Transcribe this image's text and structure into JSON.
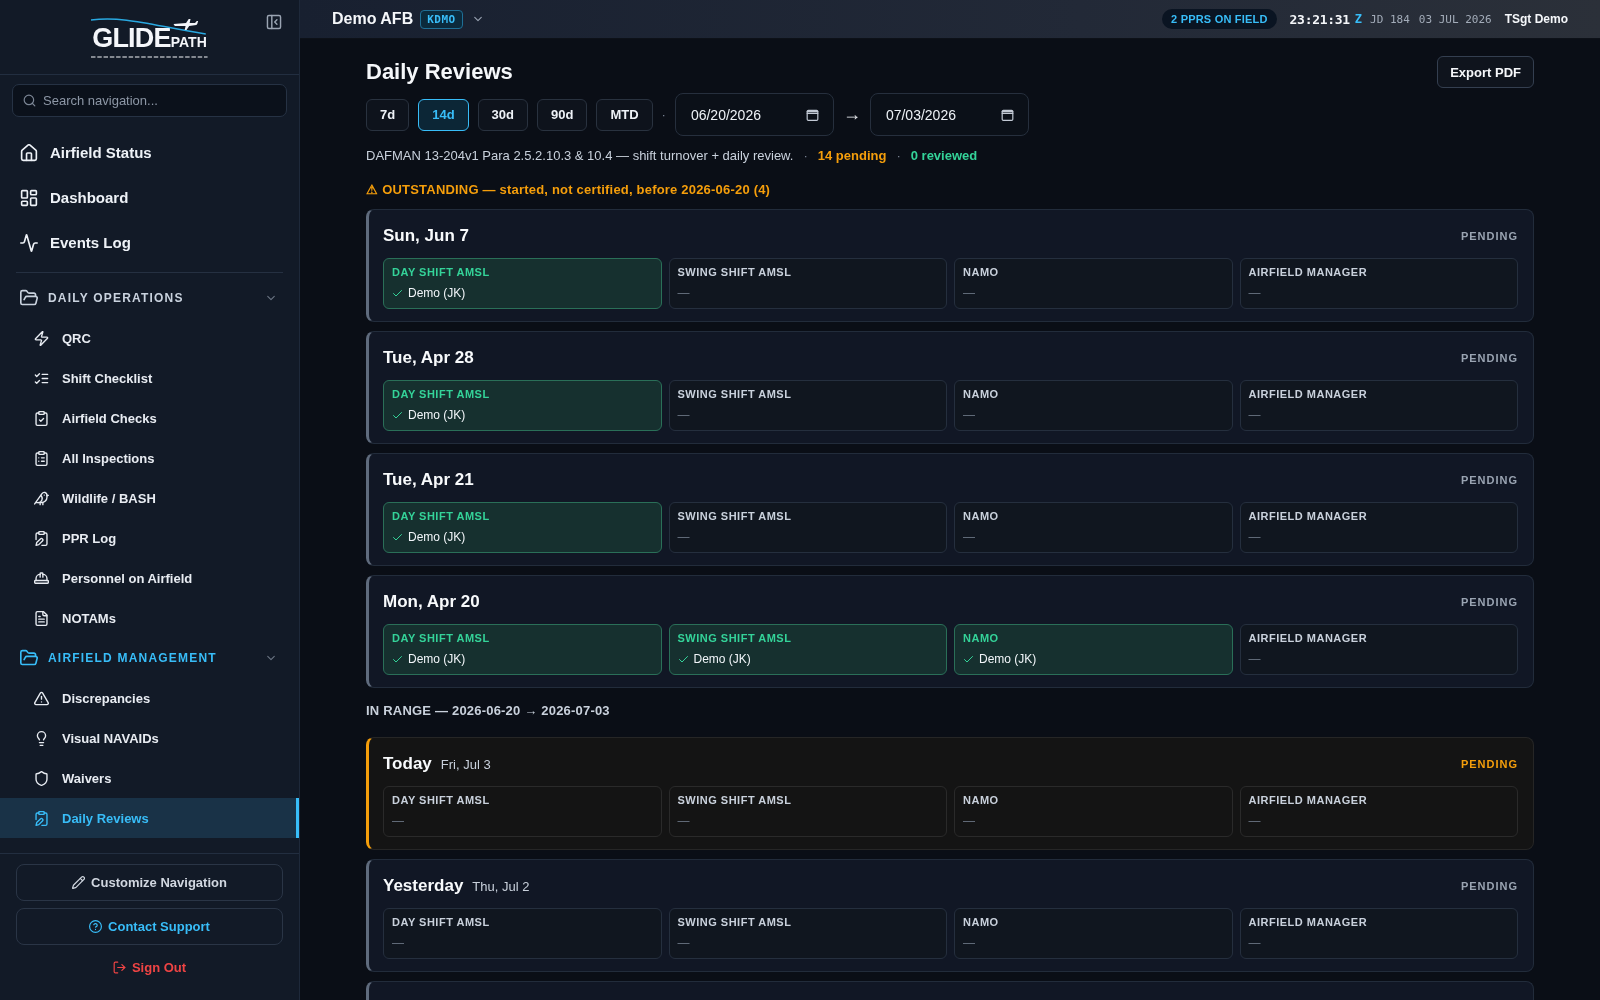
{
  "sidebar": {
    "logo": {
      "lead": "GLIDE",
      "tail": "PATH"
    },
    "search": {
      "placeholder": "Search navigation..."
    },
    "primary_items": [
      {
        "label": "Airfield Status",
        "selected": false
      },
      {
        "label": "Dashboard",
        "selected": false
      },
      {
        "label": "Events Log",
        "selected": false
      }
    ],
    "sections": [
      {
        "label": "DAILY OPERATIONS",
        "active": false,
        "expanded": true,
        "items": [
          {
            "label": "QRC",
            "selected": false
          },
          {
            "label": "Shift Checklist",
            "selected": false
          },
          {
            "label": "Airfield Checks",
            "selected": false
          },
          {
            "label": "All Inspections",
            "selected": false
          },
          {
            "label": "Wildlife / BASH",
            "selected": false
          },
          {
            "label": "PPR Log",
            "selected": false
          },
          {
            "label": "Personnel on Airfield",
            "selected": false
          },
          {
            "label": "NOTAMs",
            "selected": false
          }
        ]
      },
      {
        "label": "AIRFIELD MANAGEMENT",
        "active": true,
        "expanded": true,
        "items": [
          {
            "label": "Discrepancies",
            "selected": false
          },
          {
            "label": "Visual NAVAIDs",
            "selected": false
          },
          {
            "label": "Waivers",
            "selected": false
          },
          {
            "label": "Daily Reviews",
            "selected": true
          }
        ]
      }
    ],
    "footer_buttons": [
      {
        "kind": "customize",
        "label": "Customize Navigation"
      },
      {
        "kind": "support",
        "label": "Contact Support"
      },
      {
        "kind": "sign_out",
        "label": "Sign Out"
      }
    ]
  },
  "top_bar": {
    "base": "Demo AFB",
    "icao": "KDMO",
    "ppr_badge": "2 PPRS ON FIELD",
    "time": "23:21:31",
    "zone": "Z",
    "julian_day": "JD 184",
    "date": "03 JUL 2026",
    "user": "TSgt Demo"
  },
  "page": {
    "title": "Daily Reviews",
    "export_label": "Export PDF",
    "ranges": [
      {
        "label": "7d",
        "selected": false
      },
      {
        "label": "14d",
        "selected": true
      },
      {
        "label": "30d",
        "selected": false
      },
      {
        "label": "90d",
        "selected": false
      },
      {
        "label": "MTD",
        "selected": false
      }
    ],
    "range_separator": "·",
    "date_from": "06/20/2026",
    "date_arrow": "→",
    "date_to": "07/03/2026",
    "summary": [
      {
        "kind": "note",
        "text": "DAFMAN 13-204v1 Para 2.5.2.10.3 & 10.4 — shift turnover + daily review."
      },
      {
        "kind": "sep",
        "text": "·"
      },
      {
        "kind": "pending",
        "text": "14 pending"
      },
      {
        "kind": "sep",
        "text": "·"
      },
      {
        "kind": "reviewed",
        "text": "0 reviewed"
      }
    ]
  },
  "review_groups": [
    {
      "kind": "outstanding",
      "warning": "⚠",
      "heading": "OUTSTANDING — started, not certified, before 2026-06-20 (4)",
      "cards": [
        {
          "title": "Sun, Jun 7",
          "status": "PENDING",
          "today": false,
          "slots": [
            {
              "role": "DAY SHIFT AMSL",
              "done": true,
              "value": "Demo (JK)"
            },
            {
              "role": "SWING SHIFT AMSL",
              "done": false,
              "value": "—"
            },
            {
              "role": "NAMO",
              "done": false,
              "value": "—"
            },
            {
              "role": "AIRFIELD MANAGER",
              "done": false,
              "value": "—"
            }
          ]
        },
        {
          "title": "Tue, Apr 28",
          "status": "PENDING",
          "today": false,
          "slots": [
            {
              "role": "DAY SHIFT AMSL",
              "done": true,
              "value": "Demo (JK)"
            },
            {
              "role": "SWING SHIFT AMSL",
              "done": false,
              "value": "—"
            },
            {
              "role": "NAMO",
              "done": false,
              "value": "—"
            },
            {
              "role": "AIRFIELD MANAGER",
              "done": false,
              "value": "—"
            }
          ]
        },
        {
          "title": "Tue, Apr 21",
          "status": "PENDING",
          "today": false,
          "slots": [
            {
              "role": "DAY SHIFT AMSL",
              "done": true,
              "value": "Demo (JK)"
            },
            {
              "role": "SWING SHIFT AMSL",
              "done": false,
              "value": "—"
            },
            {
              "role": "NAMO",
              "done": false,
              "value": "—"
            },
            {
              "role": "AIRFIELD MANAGER",
              "done": false,
              "value": "—"
            }
          ]
        },
        {
          "title": "Mon, Apr 20",
          "status": "PENDING",
          "today": false,
          "slots": [
            {
              "role": "DAY SHIFT AMSL",
              "done": true,
              "value": "Demo (JK)"
            },
            {
              "role": "SWING SHIFT AMSL",
              "done": true,
              "value": "Demo (JK)"
            },
            {
              "role": "NAMO",
              "done": true,
              "value": "Demo (JK)"
            },
            {
              "role": "AIRFIELD MANAGER",
              "done": false,
              "value": "—"
            }
          ]
        }
      ]
    },
    {
      "kind": "in_range",
      "heading": "IN RANGE — 2026-06-20 → 2026-07-03",
      "cards": [
        {
          "title": "Today",
          "subtitle": "Fri, Jul 3",
          "status": "PENDING",
          "today": true,
          "slots": [
            {
              "role": "DAY SHIFT AMSL",
              "done": false,
              "value": "—"
            },
            {
              "role": "SWING SHIFT AMSL",
              "done": false,
              "value": "—"
            },
            {
              "role": "NAMO",
              "done": false,
              "value": "—"
            },
            {
              "role": "AIRFIELD MANAGER",
              "done": false,
              "value": "—"
            }
          ]
        },
        {
          "title": "Yesterday",
          "subtitle": "Thu, Jul 2",
          "status": "PENDING",
          "today": false,
          "slots": [
            {
              "role": "DAY SHIFT AMSL",
              "done": false,
              "value": "—"
            },
            {
              "role": "SWING SHIFT AMSL",
              "done": false,
              "value": "—"
            },
            {
              "role": "NAMO",
              "done": false,
              "value": "—"
            },
            {
              "role": "AIRFIELD MANAGER",
              "done": false,
              "value": "—"
            }
          ]
        }
      ]
    }
  ]
}
